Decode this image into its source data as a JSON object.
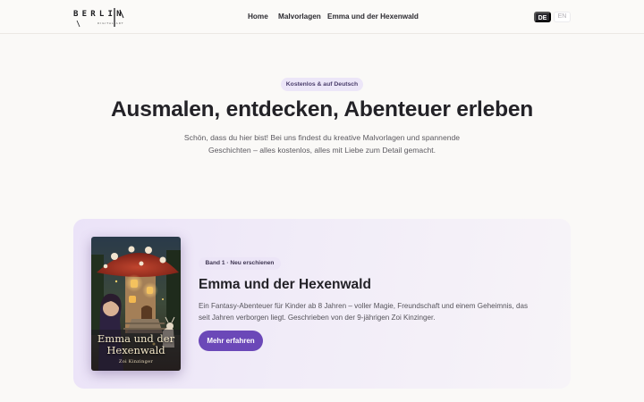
{
  "header": {
    "logo": {
      "wordmark": "BERLIN",
      "subtitle": "DIGITAL ART"
    },
    "nav": [
      {
        "label": "Home"
      },
      {
        "label": "Malvorlagen"
      },
      {
        "label": "Emma und der Hexenwald"
      }
    ],
    "languages": [
      {
        "label": "DE",
        "active": true
      },
      {
        "label": "EN",
        "active": false
      }
    ]
  },
  "hero": {
    "badge": "Kostenlos & auf Deutsch",
    "title": "Ausmalen, entdecken, Abenteuer erleben",
    "subtitle": "Schön, dass du hier bist! Bei uns findest du kreative Malvorlagen und spannende Geschichten – alles kostenlos, alles mit Liebe zum Detail gemacht."
  },
  "featured_book": {
    "badge": "Band 1 · Neu erschienen",
    "title": "Emma und der Hexenwald",
    "description": "Ein Fantasy-Abenteuer für Kinder ab 8 Jahren – voller Magie, Freundschaft und einem Geheimnis, das seit Jahren verborgen liegt. Geschrieben von der 9-jährigen Zoi Kinzinger.",
    "cta_label": "Mehr erfahren",
    "cover": {
      "title": "Emma und der Hexenwald",
      "author": "Zoi Kinzinger"
    }
  },
  "colors": {
    "accent": "#6b48b8",
    "badge_bg": "#ece6f8",
    "page_bg": "#faf9f7",
    "text_dark": "#232227"
  }
}
